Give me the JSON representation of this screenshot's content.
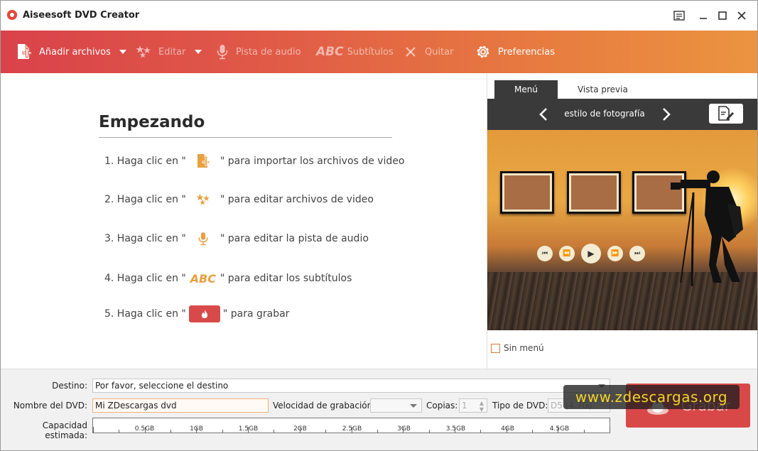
{
  "window": {
    "title": "Aiseesoft DVD Creator"
  },
  "toolbar": {
    "add_files": "Añadir archivos",
    "edit": "Editar",
    "audio_track": "Pista de audio",
    "subtitles_abc": "ABC",
    "subtitles": "Subtítulos",
    "remove": "Quitar",
    "preferences": "Preferencias"
  },
  "start": {
    "title": "Empezando",
    "steps": [
      {
        "prefix": "1. Haga clic en \"",
        "suffix": "\" para importar los archivos de video"
      },
      {
        "prefix": "2. Haga clic en \"",
        "suffix": "\" para editar archivos de video"
      },
      {
        "prefix": "3. Haga clic en \"",
        "suffix": "\" para editar la pista de audio"
      },
      {
        "prefix": "4. Haga clic en \"",
        "suffix": "\" para editar los subtítulos"
      },
      {
        "prefix": "5. Haga clic en \"",
        "suffix": "\" para grabar"
      }
    ],
    "abc_text": "ABC"
  },
  "menu_panel": {
    "tab_menu": "Menú",
    "tab_preview": "Vista previa",
    "style_name": "estilo de fotografía",
    "no_menu": "Sin menú"
  },
  "bottom": {
    "destination_label": "Destino:",
    "destination_value": "Por favor, seleccione el destino",
    "dvd_name_label": "Nombre del DVD:",
    "dvd_name_value": "Mi ZDescargas dvd",
    "speed_label": "Velocidad de grabación:",
    "copies_label": "Copias:",
    "copies_value": "1",
    "dvd_type_label": "Tipo de DVD:",
    "dvd_type_value": "D5 (4.7G)",
    "capacity_label": "Capacidad estimada:",
    "capacity_ticks": [
      "0.5GB",
      "1GB",
      "1.5GB",
      "2GB",
      "2.5GB",
      "3GB",
      "3.5GB",
      "4GB",
      "4.5GB"
    ],
    "burn_label": "Grabar",
    "watermark": "www.zdescargas.org"
  },
  "colors": {
    "toolbar_start": "#d9424a",
    "toolbar_end": "#eb9440",
    "accent_orange": "#e8a040",
    "burn_red": "#d84848"
  }
}
